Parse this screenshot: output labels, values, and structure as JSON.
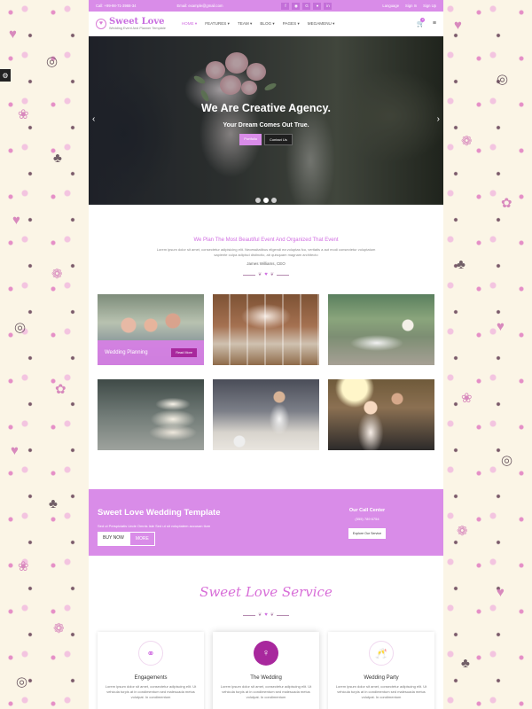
{
  "topbar": {
    "call": "Call: +99-98-71-3968-34",
    "email": "Email: example@gmail.com",
    "social_icons": [
      "facebook-icon",
      "rss-icon",
      "google-plus-icon",
      "dribbble-icon",
      "linkedin-icon"
    ],
    "language": "Language",
    "signin": "Sign In",
    "signup": "Sign Up"
  },
  "logo": {
    "title": "Sweet Love",
    "tagline": "Wedding Event And Planner Template"
  },
  "menu": [
    "HOME",
    "FEATURES",
    "TEAM",
    "BLOG",
    "PAGES",
    "MEGAMENU"
  ],
  "cart_count": "0",
  "hero": {
    "title": "We Are Creative Agency.",
    "subtitle": "Your Dream Comes Out True.",
    "btn_primary": "Portfolio",
    "btn_secondary": "Contact Us"
  },
  "intro": {
    "heading": "We Plan The Most Beautiful Event And Organized That Event",
    "text": "Lorem ipsum dolor sit amet, consectetur adipisicing elit. Necessitatibus eligendi ea voluptas fco, veritatis a aut modi consectetur voluptatum sapiente culpa adipisci distinctio, ab quisquam magnam architecto",
    "author": "James Williams, CEO"
  },
  "gallery": {
    "tile1_label": "Wedding Planning",
    "read_more": "Read More"
  },
  "promo": {
    "title": "Sweet Love Wedding Template",
    "text": "Sed ut Perspiciatis Unde Omnis Iste Sed ut sit voluptatem accusan tium",
    "buy": "BUY NOW",
    "more": "MORE",
    "call_heading": "Our Call Center",
    "call_number": "(555) 789 6754",
    "call_button": "Explore Our Service"
  },
  "service": {
    "title": "Sweet Love Service",
    "cards": [
      {
        "title": "Engagements",
        "text": "Lorem ipsum dolor sit amet, consectetur adipiscing elit. Ut vehicula turpis at in condimentum sed malesuada metus volutpat. In condimentum",
        "icon": "rings-icon"
      },
      {
        "title": "The Wedding",
        "text": "Lorem ipsum dolor sit amet, consectetur adipiscing elit. Ut vehicula turpis at in condimentum sed malesuada metus volutpat. In condimentum",
        "icon": "couple-icon"
      },
      {
        "title": "Wedding Party",
        "text": "Lorem ipsum dolor sit amet, consectetur adipiscing elit. Ut vehicula turpis at in condimentum sed malesuada metus volutpat. In condimentum",
        "icon": "champagne-icon"
      }
    ]
  },
  "colors": {
    "accent": "#d98ce8",
    "accent_dark": "#a8289d",
    "background": "#fbf5e6"
  }
}
